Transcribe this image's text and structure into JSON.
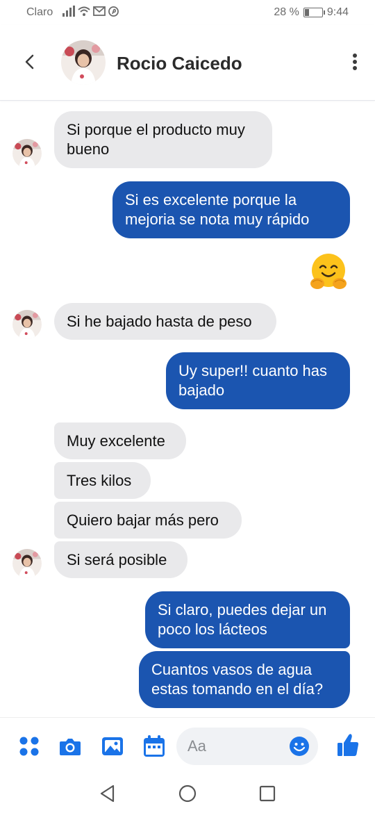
{
  "status_bar": {
    "carrier": "Claro",
    "battery": "28 %",
    "battery_level": 0.28,
    "time": "9:44"
  },
  "header": {
    "contact_name": "Rocio Caicedo"
  },
  "messages": [
    {
      "from": "contact",
      "text": "Si porque el producto muy\nbueno"
    },
    {
      "from": "me",
      "text": "Si es excelente porque la\nmejoria se nota muy rápido"
    },
    {
      "from": "me",
      "emoji": "hugging-face-emoji"
    },
    {
      "from": "contact",
      "text": "Si he bajado hasta de peso"
    },
    {
      "from": "me",
      "text": "Uy super!! cuanto has\nbajado"
    },
    {
      "from": "contact",
      "text": "Muy excelente"
    },
    {
      "from": "contact",
      "text": "Tres kilos"
    },
    {
      "from": "contact",
      "text": "Quiero bajar más pero"
    },
    {
      "from": "contact",
      "text": "Si será posible"
    },
    {
      "from": "me",
      "text": "Si claro, puedes dejar un\npoco los lácteos"
    },
    {
      "from": "me",
      "text": "Cuantos vasos de agua\nestas tomando en el día?"
    }
  ],
  "composer": {
    "placeholder": "Aa"
  },
  "icons": {
    "back": "back-arrow-icon",
    "more": "more-vertical-icon",
    "apps": "apps-grid-icon",
    "camera": "camera-icon",
    "gallery": "image-gallery-icon",
    "calendar": "calendar-icon",
    "emoji": "emoji-smile-icon",
    "like": "thumbs-up-icon"
  },
  "colors": {
    "accent": "#1b55b0",
    "icon_blue": "#1a73e8",
    "incoming_bubble": "#e9e9eb",
    "emoji_button": "#1a73e8"
  }
}
